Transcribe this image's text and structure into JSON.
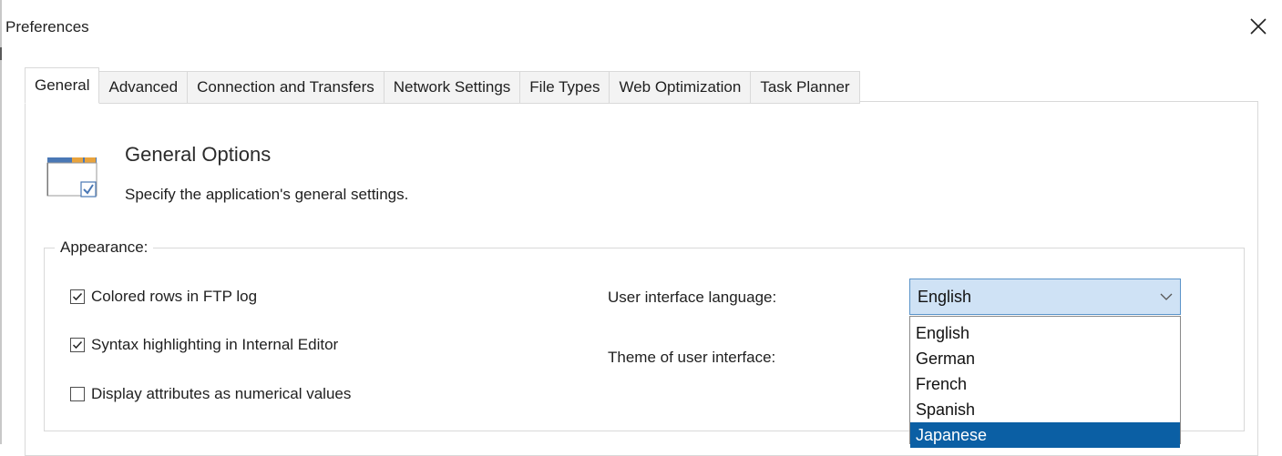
{
  "window": {
    "title": "Preferences",
    "close_icon": "close-icon"
  },
  "tabs": [
    {
      "label": "General",
      "active": true
    },
    {
      "label": "Advanced",
      "active": false
    },
    {
      "label": "Connection and Transfers",
      "active": false
    },
    {
      "label": "Network Settings",
      "active": false
    },
    {
      "label": "File Types",
      "active": false
    },
    {
      "label": "Web Optimization",
      "active": false
    },
    {
      "label": "Task Planner",
      "active": false
    }
  ],
  "header": {
    "icon": "general-options-icon",
    "title": "General Options",
    "subtitle": "Specify the application's general settings."
  },
  "appearance": {
    "group_label": "Appearance:",
    "options": [
      {
        "label": "Colored rows in FTP log",
        "checked": true
      },
      {
        "label": "Syntax highlighting in Internal Editor",
        "checked": true
      },
      {
        "label": "Display attributes as numerical values",
        "checked": false
      }
    ],
    "language_label": "User interface language:",
    "theme_label": "Theme of user interface:",
    "language_value": "English",
    "language_options": [
      "English",
      "German",
      "French",
      "Spanish",
      "Japanese"
    ],
    "highlighted_option": "Japanese"
  },
  "colors": {
    "combo_bg": "#cfe2f5",
    "combo_border": "#5a93c9",
    "selection": "#0b5fa4",
    "icon_accent": "#e8a33d",
    "icon_blue": "#4a78b5"
  }
}
